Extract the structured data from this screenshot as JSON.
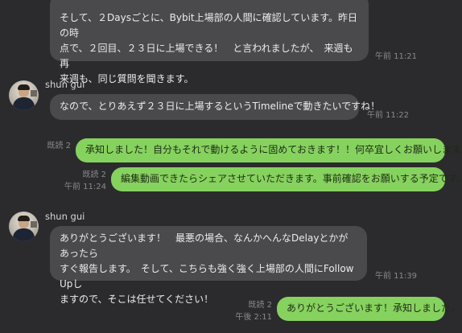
{
  "messages": [
    {
      "text": "そして、２Daysごとに、Bybit上場部の人間に確認しています。昨日の時\n点で、２回目、２３日に上場できる！　と言われましたが、　来週も再\n来週も、同じ質問を聞きます。",
      "time": "午前 11:21"
    },
    {
      "sender": "shun gui",
      "text": "なので、とりあえず２３日に上場するというTimelineで動きたいですね！",
      "time": "午前 11:22"
    },
    {
      "read": "既読 2",
      "text": "承知しました！自分もそれで動けるように固めておきます！！何卒宜しくお願いします。"
    },
    {
      "read": "既読 2",
      "time": "午前 11:24",
      "text": "編集動画できたらシェアさせていただきます。事前確認をお願いする予定です。"
    },
    {
      "sender": "shun gui",
      "text": "ありがとうございます！　最悪の場合、なんかへんなDelayとかがあったら\nすぐ報告します。　そして、こちらも強く強く上場部の人間にFollow Upし\nますので、そこは任せてください！",
      "time": "午前 11:39"
    },
    {
      "read": "既読 2",
      "time": "午後 2:11",
      "text": "ありがとうございます！承知しました。"
    }
  ]
}
